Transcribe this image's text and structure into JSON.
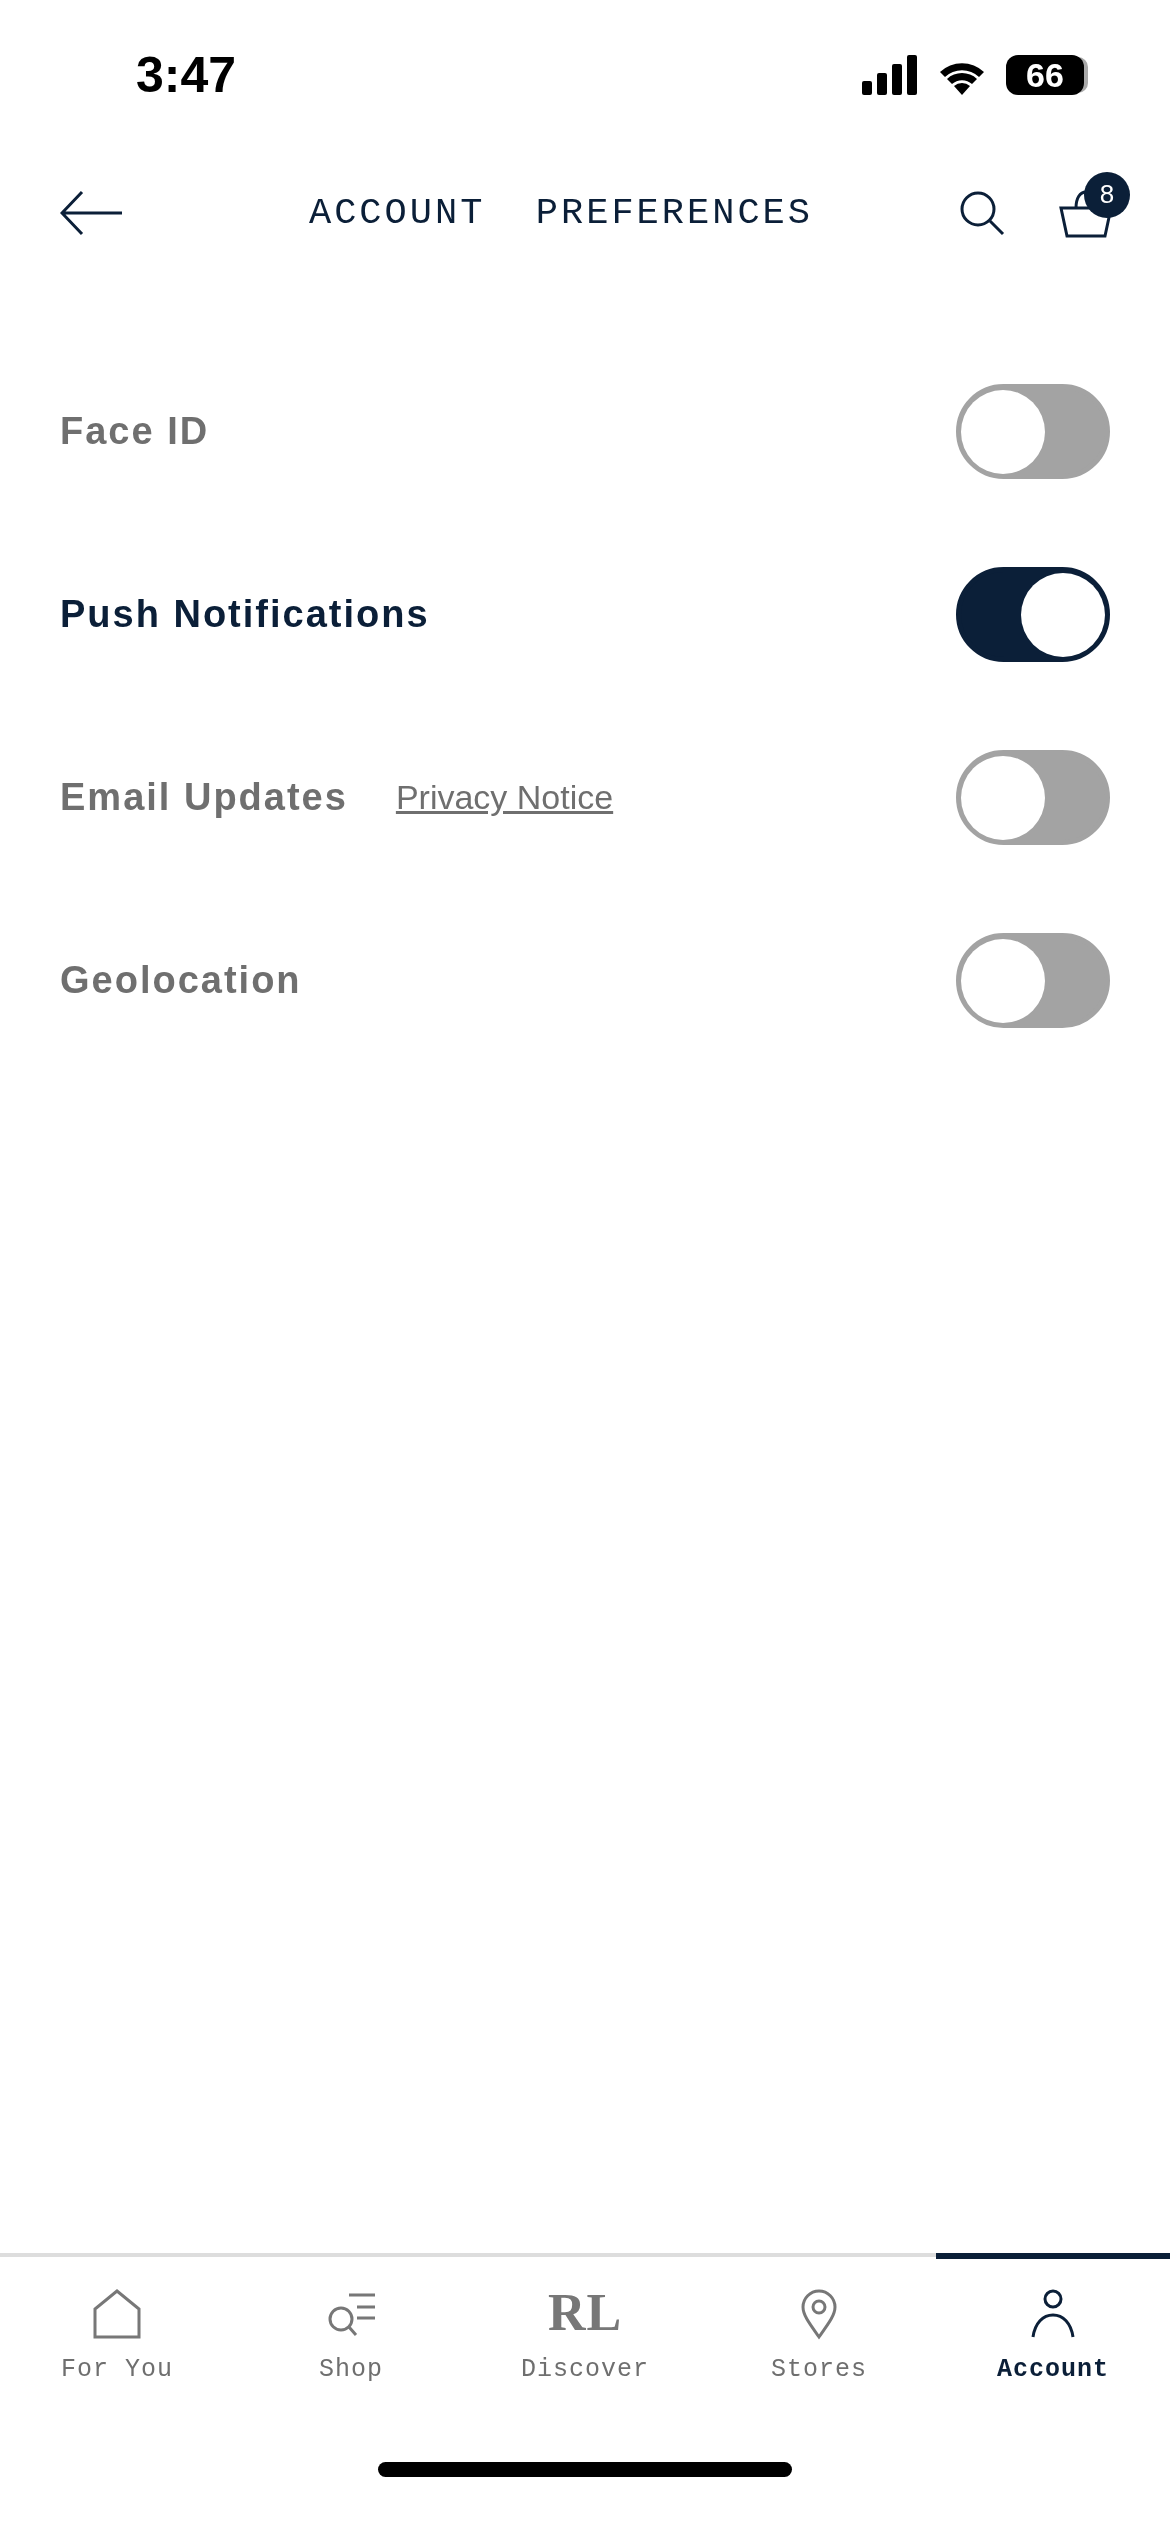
{
  "status_bar": {
    "time": "3:47",
    "battery": "66"
  },
  "header": {
    "title": "ACCOUNT  PREFERENCES",
    "cart_count": "8"
  },
  "settings": [
    {
      "label": "Face ID",
      "on": false
    },
    {
      "label": "Push Notifications",
      "on": true
    },
    {
      "label": "Email Updates",
      "link": "Privacy Notice",
      "on": false
    },
    {
      "label": "Geolocation",
      "on": false
    }
  ],
  "tabs": [
    {
      "kind": "home",
      "label": "For You",
      "selected": false
    },
    {
      "kind": "shop",
      "label": "Shop",
      "selected": false
    },
    {
      "kind": "logo",
      "logo": "RL",
      "label": "Discover",
      "selected": false
    },
    {
      "kind": "pin",
      "label": "Stores",
      "selected": false
    },
    {
      "kind": "person",
      "label": "Account",
      "selected": true
    }
  ]
}
